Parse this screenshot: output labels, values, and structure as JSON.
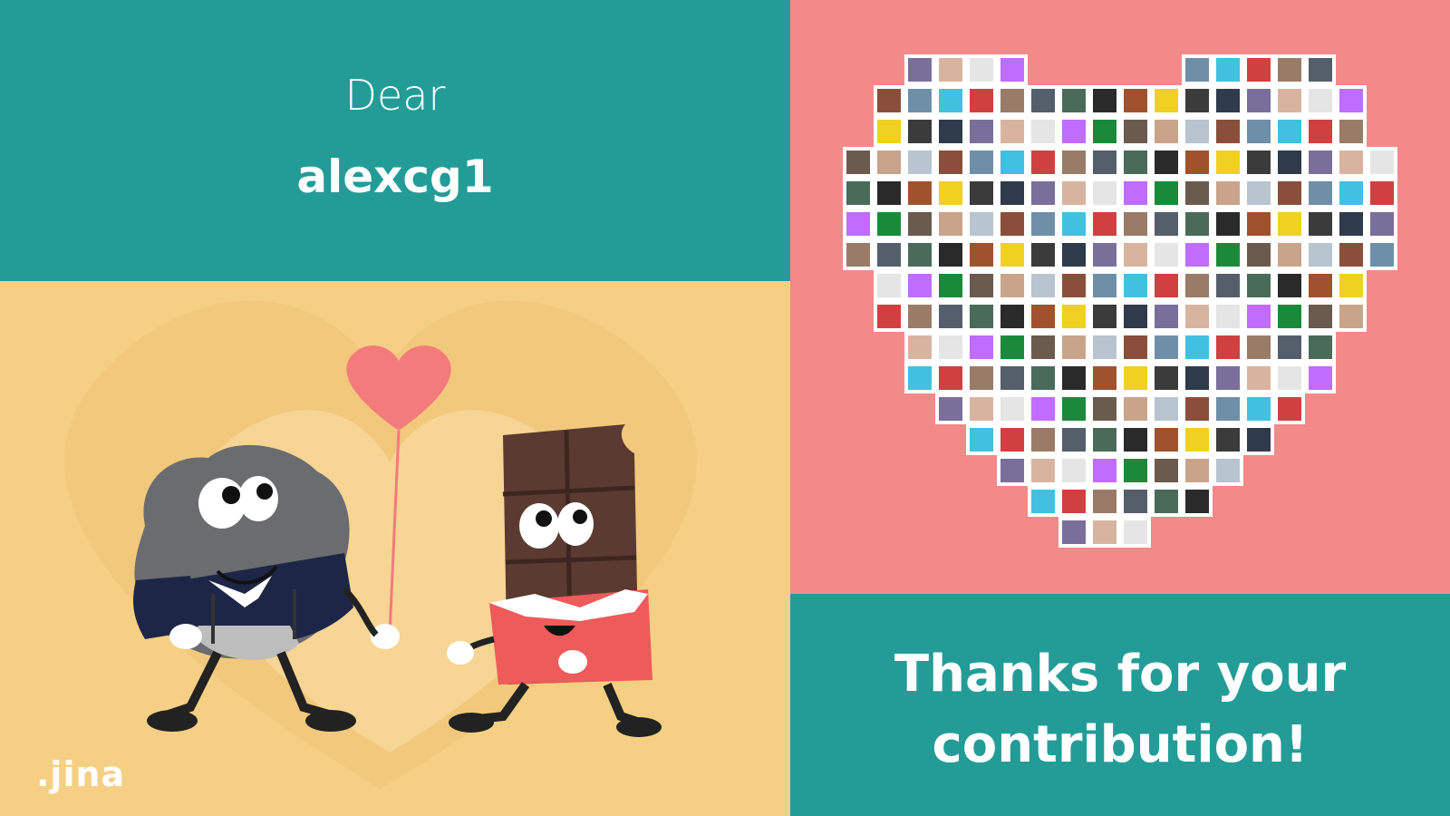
{
  "card": {
    "greeting": "Dear",
    "username": "alexcg1",
    "thanks_line1": "Thanks for your",
    "thanks_line2": "contribution!",
    "logo_text": ".jina"
  },
  "colors": {
    "teal": "#239c98",
    "pink": "#f28a89",
    "yellow": "#f5cf83",
    "balloon": "#f47b7b"
  }
}
